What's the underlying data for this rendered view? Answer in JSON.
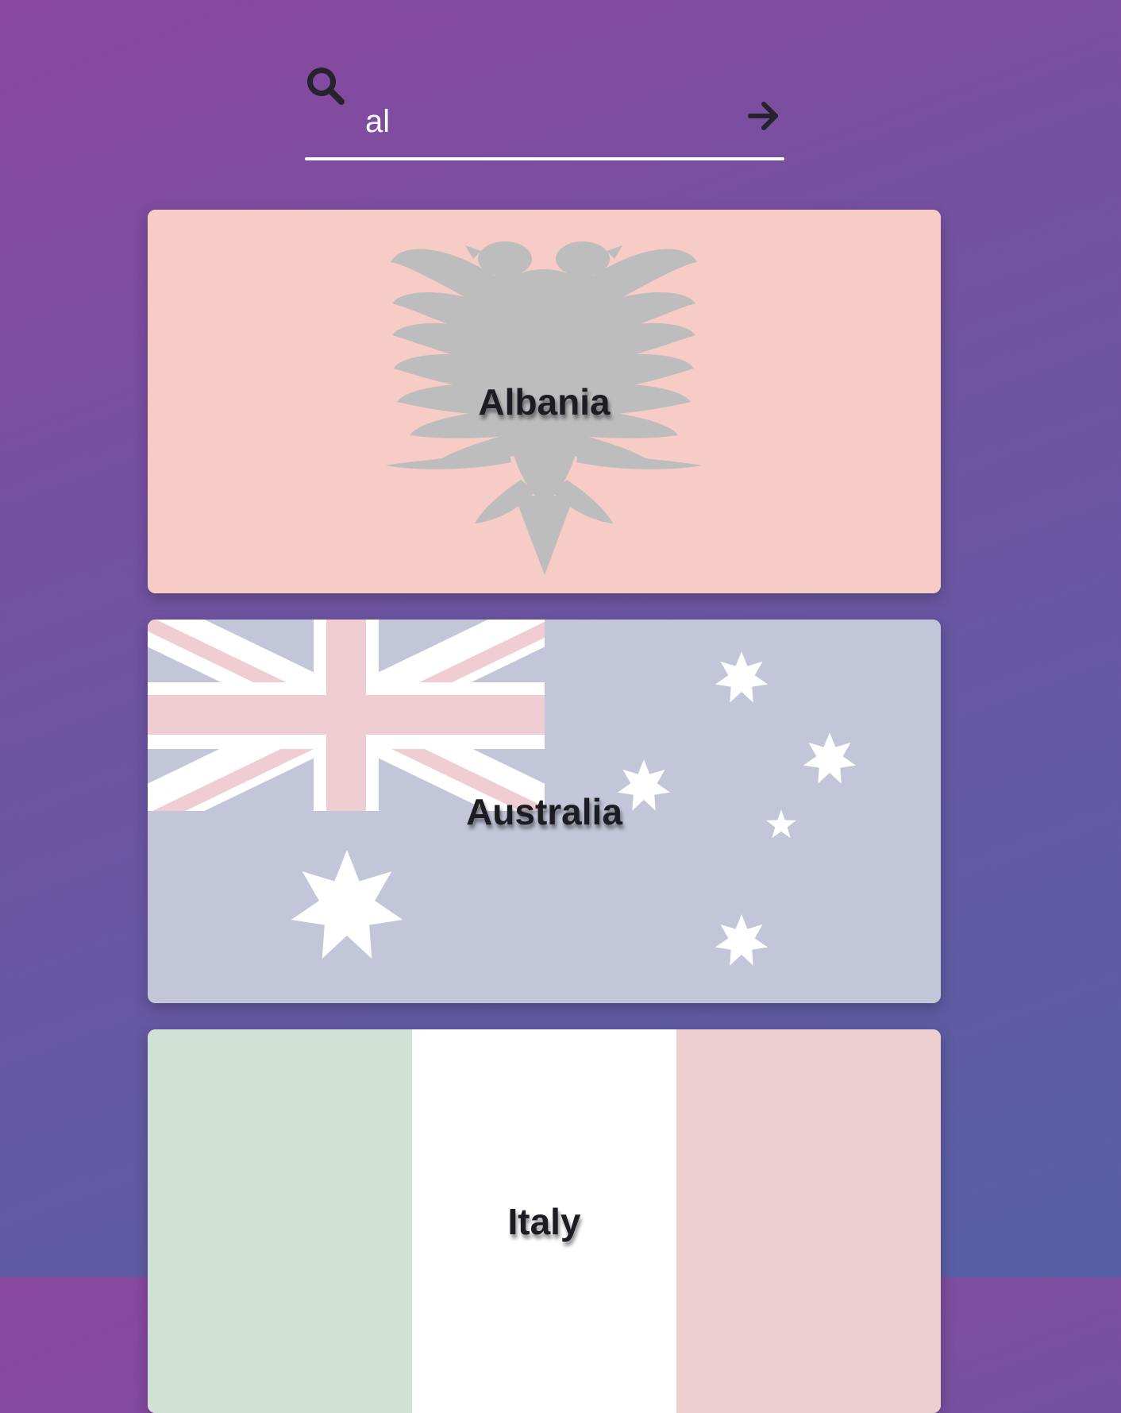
{
  "search": {
    "value": "al",
    "placeholder": "",
    "icon": "search-icon",
    "submit_icon": "arrow-right-icon"
  },
  "results": [
    {
      "name": "Albania",
      "flag": "albania-flag",
      "colors": {
        "field": "#f7cbc6",
        "emblem": "#bdbdbd"
      }
    },
    {
      "name": "Australia",
      "flag": "australia-flag",
      "colors": {
        "field": "#c2c6d8",
        "cross": "#f0cdd2",
        "white": "#ffffff"
      }
    },
    {
      "name": "Italy",
      "flag": "italy-flag",
      "colors": {
        "green": "#cfe2d5",
        "white": "#ffffff",
        "red": "#eecfcf"
      }
    }
  ],
  "colors": {
    "background_start": "#8a479f",
    "background_end": "#565fa3",
    "text_dark": "#1c1c22"
  }
}
